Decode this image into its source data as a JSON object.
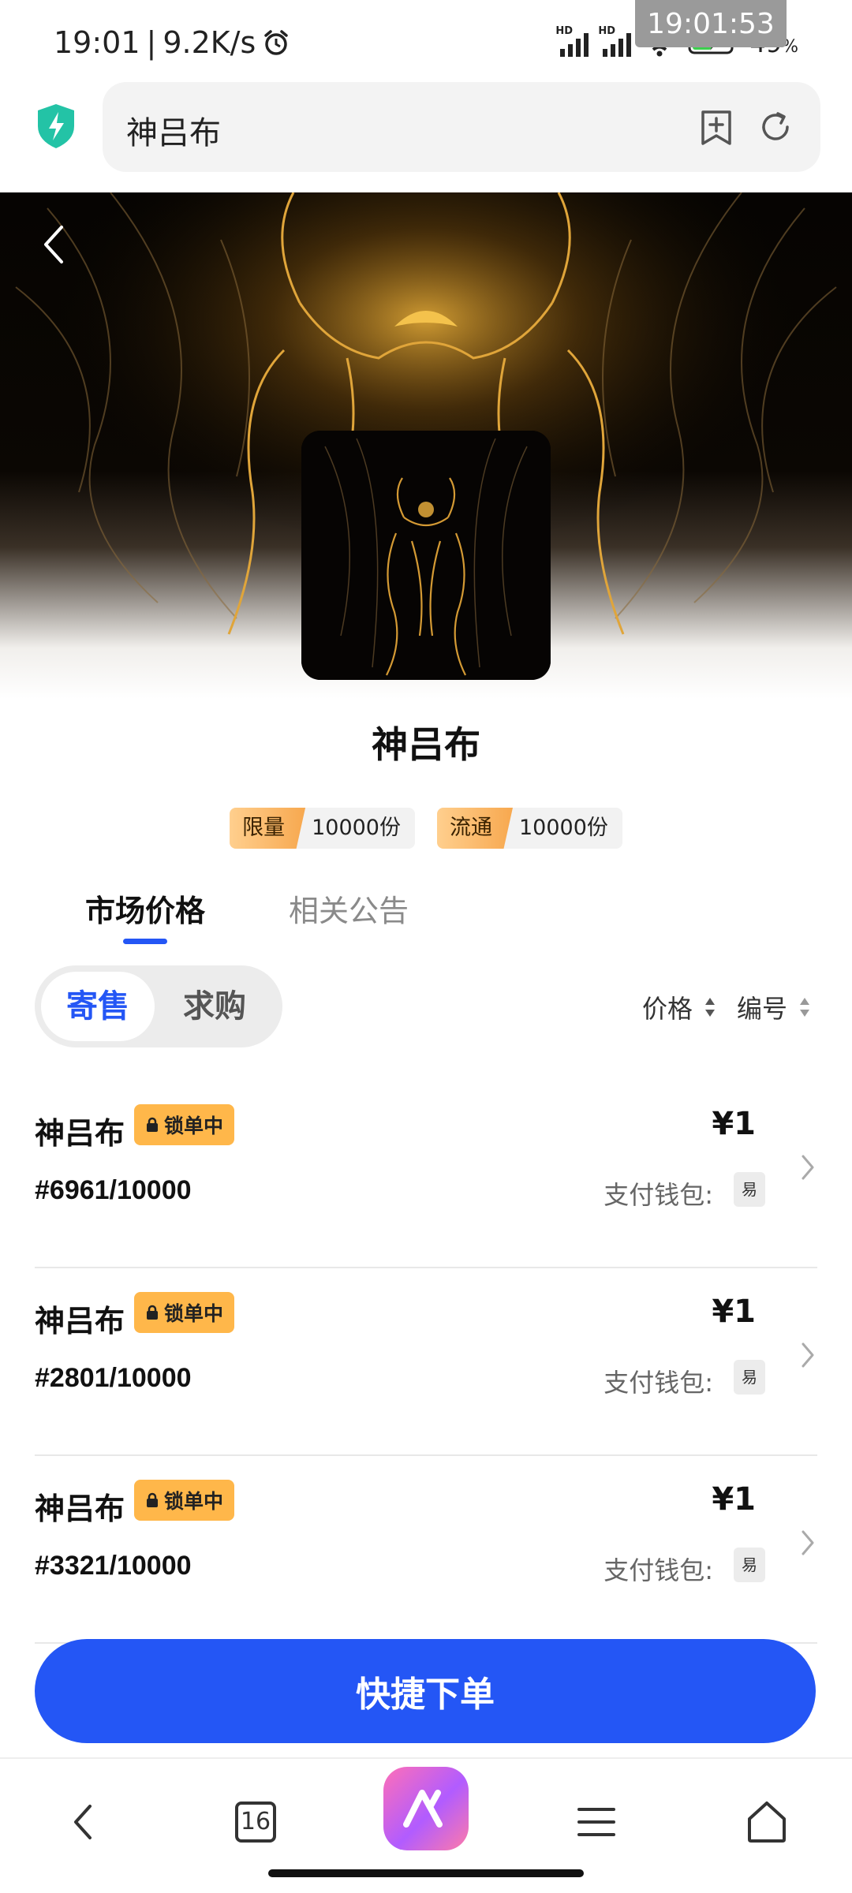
{
  "status": {
    "time": "19:01",
    "speed": "9.2K/s",
    "battery": "49",
    "battery_unit": "%",
    "hd": "HD",
    "overlay_time": "19:01:53"
  },
  "browser": {
    "address_text": "神吕布",
    "tabs_count": "16"
  },
  "product": {
    "title": "神吕布",
    "pills": [
      {
        "key": "限量",
        "value": "10000份"
      },
      {
        "key": "流通",
        "value": "10000份"
      }
    ]
  },
  "tabs": {
    "market": "市场价格",
    "notice": "相关公告"
  },
  "segment": {
    "sell": "寄售",
    "buy": "求购"
  },
  "sort": {
    "price": "价格",
    "number": "编号"
  },
  "listings": [
    {
      "name": "神吕布",
      "badge": "锁单中",
      "serial": "#6961/10000",
      "price": "¥1",
      "wallet_label": "支付钱包:",
      "wallet_tag": "易"
    },
    {
      "name": "神吕布",
      "badge": "锁单中",
      "serial": "#2801/10000",
      "price": "¥1",
      "wallet_label": "支付钱包:",
      "wallet_tag": "易"
    },
    {
      "name": "神吕布",
      "badge": "锁单中",
      "serial": "#3321/10000",
      "price": "¥1",
      "wallet_label": "支付钱包:",
      "wallet_tag": "易"
    }
  ],
  "actions": {
    "quick_order": "快捷下单"
  },
  "colors": {
    "accent": "#2456f5",
    "badge": "#ffb74a",
    "gold": "#d9a23a"
  },
  "icons": [
    "shield-bolt-icon",
    "bookmark-add-icon",
    "reload-icon",
    "back-arrow-icon",
    "lock-icon",
    "sort-icon",
    "chevron-right-icon",
    "nav-back-icon",
    "tabs-icon",
    "ai-assistant-icon",
    "menu-icon",
    "home-icon",
    "alarm-icon",
    "wifi-icon",
    "battery-icon"
  ]
}
